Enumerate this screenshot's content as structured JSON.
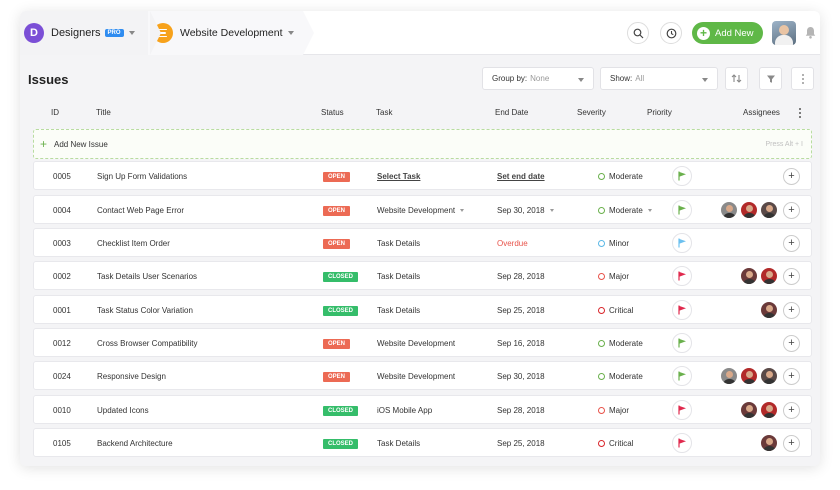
{
  "workspace": {
    "initial": "D",
    "name": "Designers",
    "badge": "PRO"
  },
  "project": {
    "name": "Website Development"
  },
  "header": {
    "add_new_label": "Add New"
  },
  "page": {
    "title": "Issues"
  },
  "filters": {
    "group_by_label": "Group by:",
    "group_by_value": "None",
    "show_label": "Show:",
    "show_value": "All"
  },
  "table": {
    "columns": {
      "id": "ID",
      "title": "Title",
      "status": "Status",
      "task": "Task",
      "end_date": "End Date",
      "severity": "Severity",
      "priority": "Priority",
      "assignees": "Assignees"
    },
    "add_issue_label": "Add New Issue",
    "add_issue_hint": "Press Alt + I",
    "rows": [
      {
        "id": "0005",
        "title": "Sign Up Form Validations",
        "status": "OPEN",
        "task": "Select Task",
        "end_date": "Set end date",
        "severity": "Moderate",
        "severity_color": "#6ab04c",
        "flag_color": "#6ab04c"
      },
      {
        "id": "0004",
        "title": "Contact Web Page Error",
        "status": "OPEN",
        "task": "Website Development",
        "end_date": "Sep 30, 2018",
        "severity": "Moderate",
        "severity_color": "#6ab04c",
        "flag_color": "#6ab04c"
      },
      {
        "id": "0003",
        "title": "Checklist Item Order",
        "status": "OPEN",
        "task": "Task Details",
        "end_date": "Overdue",
        "severity": "Minor",
        "severity_color": "#5bb8e6",
        "flag_color": "#6cc0ef"
      },
      {
        "id": "0002",
        "title": "Task Details User Scenarios",
        "status": "CLOSED",
        "task": "Task Details",
        "end_date": "Sep 28, 2018",
        "severity": "Major",
        "severity_color": "#e8534a",
        "flag_color": "#e0294d"
      },
      {
        "id": "0001",
        "title": "Task Status Color Variation",
        "status": "CLOSED",
        "task": "Task Details",
        "end_date": "Sep 25, 2018",
        "severity": "Critical",
        "severity_color": "#d9262b",
        "flag_color": "#e0294d"
      },
      {
        "id": "0012",
        "title": "Cross Browser Compatibility",
        "status": "OPEN",
        "task": "Website Development",
        "end_date": "Sep 16, 2018",
        "severity": "Moderate",
        "severity_color": "#6ab04c",
        "flag_color": "#6ab04c"
      },
      {
        "id": "0024",
        "title": "Responsive Design",
        "status": "OPEN",
        "task": "Website Development",
        "end_date": "Sep 30, 2018",
        "severity": "Moderate",
        "severity_color": "#6ab04c",
        "flag_color": "#6ab04c"
      },
      {
        "id": "0010",
        "title": "Updated Icons",
        "status": "CLOSED",
        "task": "iOS Mobile App",
        "end_date": "Sep 28, 2018",
        "severity": "Major",
        "severity_color": "#e8534a",
        "flag_color": "#e0294d"
      },
      {
        "id": "0105",
        "title": "Backend Architecture",
        "status": "CLOSED",
        "task": "Task Details",
        "end_date": "Sep 25, 2018",
        "severity": "Critical",
        "severity_color": "#d9262b",
        "flag_color": "#e0294d"
      }
    ]
  },
  "colors": {
    "accent_green": "#5fb847",
    "open": "#ec6a54",
    "closed": "#35bd6a",
    "workspace": "#7b4fd6",
    "project": "#f7a21b"
  }
}
